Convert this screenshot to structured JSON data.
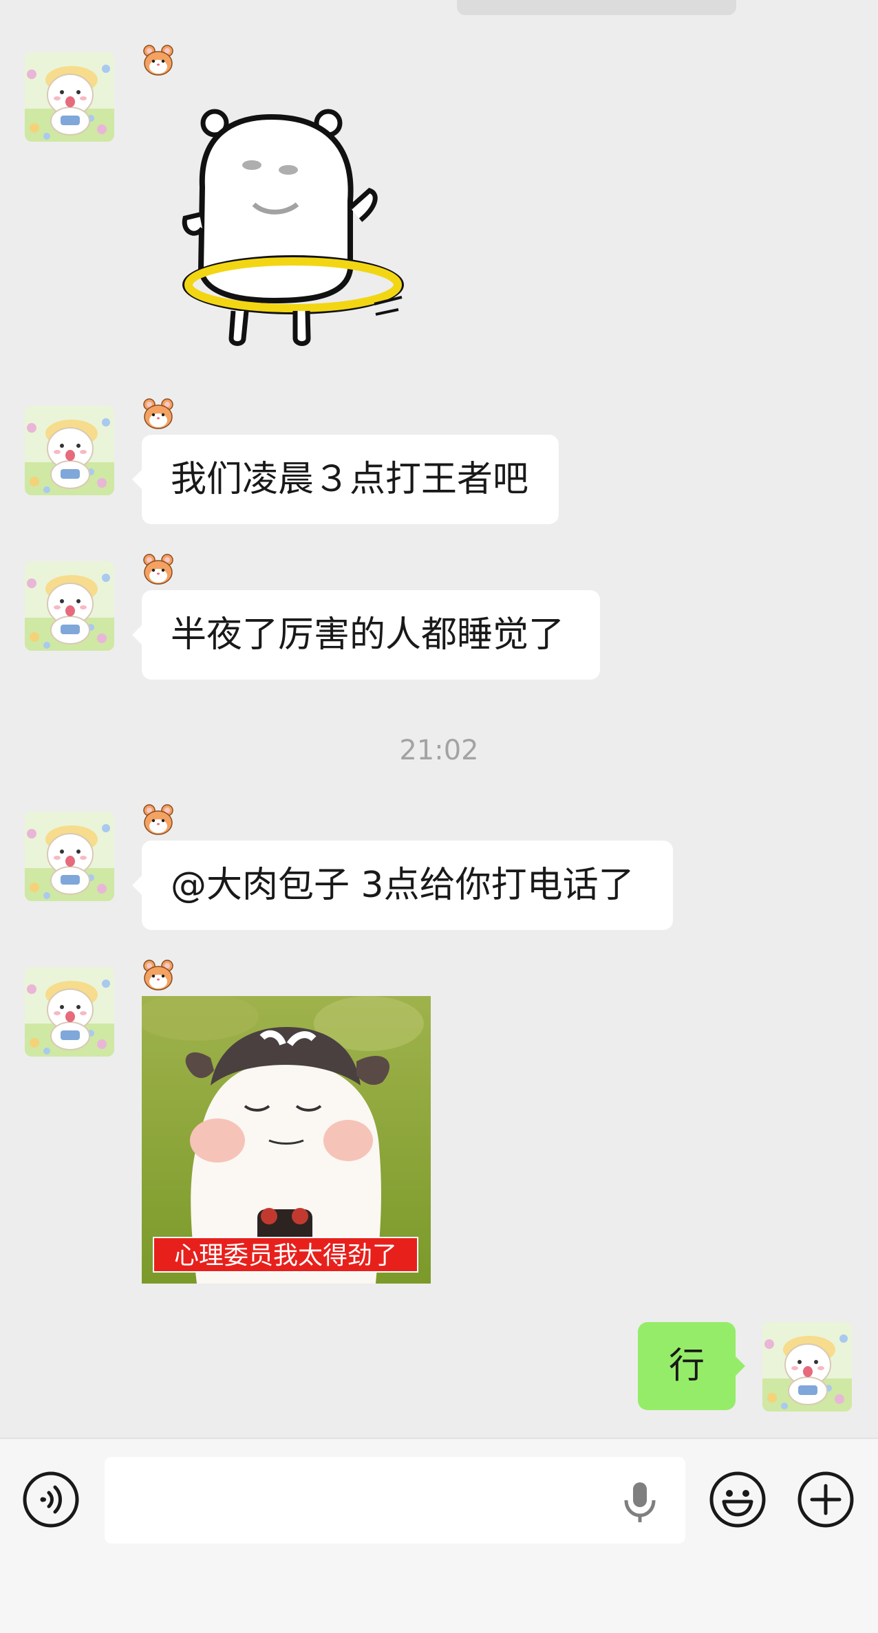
{
  "messages": [
    {
      "type": "sticker",
      "from": "other",
      "sticker": "white-bear-hula-hoop"
    },
    {
      "type": "text",
      "from": "other",
      "text": "我们凌晨３点打王者吧"
    },
    {
      "type": "text",
      "from": "other",
      "text": "半夜了厉害的人都睡觉了"
    },
    {
      "type": "timestamp",
      "text": "21:02"
    },
    {
      "type": "text",
      "from": "other",
      "text": "@大肉包子 3点给你打电话了"
    },
    {
      "type": "sticker",
      "from": "other",
      "sticker": "cow-meme",
      "caption": "心理委员我太得劲了"
    },
    {
      "type": "text",
      "from": "me",
      "text": "行"
    }
  ],
  "input": {
    "value": "",
    "placeholder": ""
  },
  "icons": {
    "voice": "voice-wave-icon",
    "mic": "microphone-icon",
    "emoji": "smiley-icon",
    "more": "plus-icon",
    "badge": "hamster-icon"
  },
  "colors": {
    "background": "#ededed",
    "sent_bubble": "#95ec69",
    "received_bubble": "#ffffff",
    "timestamp": "#a3a3a3",
    "caption_bg": "#e8201c"
  }
}
